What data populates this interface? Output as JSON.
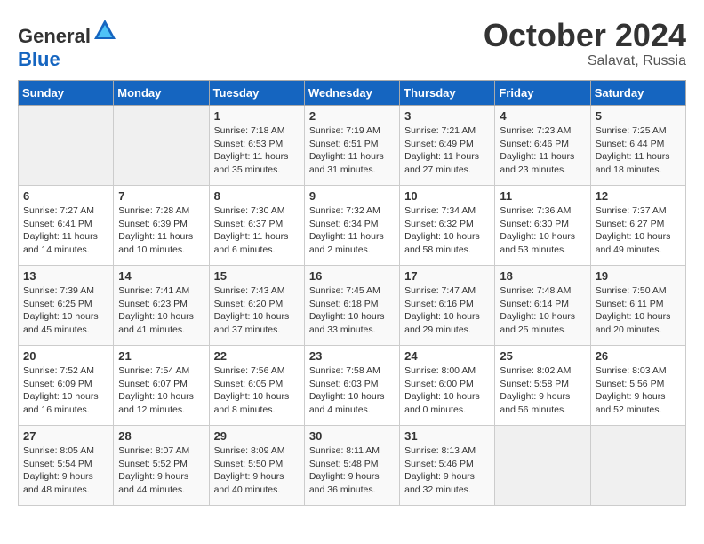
{
  "logo": {
    "general": "General",
    "blue": "Blue"
  },
  "title": "October 2024",
  "subtitle": "Salavat, Russia",
  "days_of_week": [
    "Sunday",
    "Monday",
    "Tuesday",
    "Wednesday",
    "Thursday",
    "Friday",
    "Saturday"
  ],
  "weeks": [
    [
      {
        "day": null,
        "sunrise": null,
        "sunset": null,
        "daylight": null
      },
      {
        "day": null,
        "sunrise": null,
        "sunset": null,
        "daylight": null
      },
      {
        "day": "1",
        "sunrise": "Sunrise: 7:18 AM",
        "sunset": "Sunset: 6:53 PM",
        "daylight": "Daylight: 11 hours and 35 minutes."
      },
      {
        "day": "2",
        "sunrise": "Sunrise: 7:19 AM",
        "sunset": "Sunset: 6:51 PM",
        "daylight": "Daylight: 11 hours and 31 minutes."
      },
      {
        "day": "3",
        "sunrise": "Sunrise: 7:21 AM",
        "sunset": "Sunset: 6:49 PM",
        "daylight": "Daylight: 11 hours and 27 minutes."
      },
      {
        "day": "4",
        "sunrise": "Sunrise: 7:23 AM",
        "sunset": "Sunset: 6:46 PM",
        "daylight": "Daylight: 11 hours and 23 minutes."
      },
      {
        "day": "5",
        "sunrise": "Sunrise: 7:25 AM",
        "sunset": "Sunset: 6:44 PM",
        "daylight": "Daylight: 11 hours and 18 minutes."
      }
    ],
    [
      {
        "day": "6",
        "sunrise": "Sunrise: 7:27 AM",
        "sunset": "Sunset: 6:41 PM",
        "daylight": "Daylight: 11 hours and 14 minutes."
      },
      {
        "day": "7",
        "sunrise": "Sunrise: 7:28 AM",
        "sunset": "Sunset: 6:39 PM",
        "daylight": "Daylight: 11 hours and 10 minutes."
      },
      {
        "day": "8",
        "sunrise": "Sunrise: 7:30 AM",
        "sunset": "Sunset: 6:37 PM",
        "daylight": "Daylight: 11 hours and 6 minutes."
      },
      {
        "day": "9",
        "sunrise": "Sunrise: 7:32 AM",
        "sunset": "Sunset: 6:34 PM",
        "daylight": "Daylight: 11 hours and 2 minutes."
      },
      {
        "day": "10",
        "sunrise": "Sunrise: 7:34 AM",
        "sunset": "Sunset: 6:32 PM",
        "daylight": "Daylight: 10 hours and 58 minutes."
      },
      {
        "day": "11",
        "sunrise": "Sunrise: 7:36 AM",
        "sunset": "Sunset: 6:30 PM",
        "daylight": "Daylight: 10 hours and 53 minutes."
      },
      {
        "day": "12",
        "sunrise": "Sunrise: 7:37 AM",
        "sunset": "Sunset: 6:27 PM",
        "daylight": "Daylight: 10 hours and 49 minutes."
      }
    ],
    [
      {
        "day": "13",
        "sunrise": "Sunrise: 7:39 AM",
        "sunset": "Sunset: 6:25 PM",
        "daylight": "Daylight: 10 hours and 45 minutes."
      },
      {
        "day": "14",
        "sunrise": "Sunrise: 7:41 AM",
        "sunset": "Sunset: 6:23 PM",
        "daylight": "Daylight: 10 hours and 41 minutes."
      },
      {
        "day": "15",
        "sunrise": "Sunrise: 7:43 AM",
        "sunset": "Sunset: 6:20 PM",
        "daylight": "Daylight: 10 hours and 37 minutes."
      },
      {
        "day": "16",
        "sunrise": "Sunrise: 7:45 AM",
        "sunset": "Sunset: 6:18 PM",
        "daylight": "Daylight: 10 hours and 33 minutes."
      },
      {
        "day": "17",
        "sunrise": "Sunrise: 7:47 AM",
        "sunset": "Sunset: 6:16 PM",
        "daylight": "Daylight: 10 hours and 29 minutes."
      },
      {
        "day": "18",
        "sunrise": "Sunrise: 7:48 AM",
        "sunset": "Sunset: 6:14 PM",
        "daylight": "Daylight: 10 hours and 25 minutes."
      },
      {
        "day": "19",
        "sunrise": "Sunrise: 7:50 AM",
        "sunset": "Sunset: 6:11 PM",
        "daylight": "Daylight: 10 hours and 20 minutes."
      }
    ],
    [
      {
        "day": "20",
        "sunrise": "Sunrise: 7:52 AM",
        "sunset": "Sunset: 6:09 PM",
        "daylight": "Daylight: 10 hours and 16 minutes."
      },
      {
        "day": "21",
        "sunrise": "Sunrise: 7:54 AM",
        "sunset": "Sunset: 6:07 PM",
        "daylight": "Daylight: 10 hours and 12 minutes."
      },
      {
        "day": "22",
        "sunrise": "Sunrise: 7:56 AM",
        "sunset": "Sunset: 6:05 PM",
        "daylight": "Daylight: 10 hours and 8 minutes."
      },
      {
        "day": "23",
        "sunrise": "Sunrise: 7:58 AM",
        "sunset": "Sunset: 6:03 PM",
        "daylight": "Daylight: 10 hours and 4 minutes."
      },
      {
        "day": "24",
        "sunrise": "Sunrise: 8:00 AM",
        "sunset": "Sunset: 6:00 PM",
        "daylight": "Daylight: 10 hours and 0 minutes."
      },
      {
        "day": "25",
        "sunrise": "Sunrise: 8:02 AM",
        "sunset": "Sunset: 5:58 PM",
        "daylight": "Daylight: 9 hours and 56 minutes."
      },
      {
        "day": "26",
        "sunrise": "Sunrise: 8:03 AM",
        "sunset": "Sunset: 5:56 PM",
        "daylight": "Daylight: 9 hours and 52 minutes."
      }
    ],
    [
      {
        "day": "27",
        "sunrise": "Sunrise: 8:05 AM",
        "sunset": "Sunset: 5:54 PM",
        "daylight": "Daylight: 9 hours and 48 minutes."
      },
      {
        "day": "28",
        "sunrise": "Sunrise: 8:07 AM",
        "sunset": "Sunset: 5:52 PM",
        "daylight": "Daylight: 9 hours and 44 minutes."
      },
      {
        "day": "29",
        "sunrise": "Sunrise: 8:09 AM",
        "sunset": "Sunset: 5:50 PM",
        "daylight": "Daylight: 9 hours and 40 minutes."
      },
      {
        "day": "30",
        "sunrise": "Sunrise: 8:11 AM",
        "sunset": "Sunset: 5:48 PM",
        "daylight": "Daylight: 9 hours and 36 minutes."
      },
      {
        "day": "31",
        "sunrise": "Sunrise: 8:13 AM",
        "sunset": "Sunset: 5:46 PM",
        "daylight": "Daylight: 9 hours and 32 minutes."
      },
      {
        "day": null,
        "sunrise": null,
        "sunset": null,
        "daylight": null
      },
      {
        "day": null,
        "sunrise": null,
        "sunset": null,
        "daylight": null
      }
    ]
  ]
}
